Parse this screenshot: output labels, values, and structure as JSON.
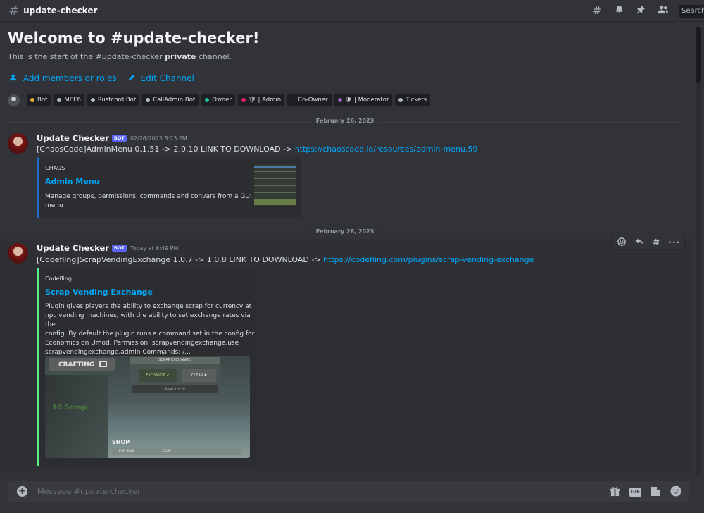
{
  "header": {
    "channel_name": "update-checker",
    "search_placeholder": "Search"
  },
  "welcome": {
    "title": "Welcome to #update-checker!",
    "sub_prefix": "This is the start of the #update-checker",
    "sub_bold": "private",
    "sub_suffix": "channel.",
    "add_members": "Add members or roles",
    "edit_channel": "Edit Channel"
  },
  "roles": [
    {
      "label": "Bot",
      "color": "#f0b232"
    },
    {
      "label": "MEE6",
      "color": "#b5bac1"
    },
    {
      "label": "Rustcord Bot",
      "color": "#b5bac1"
    },
    {
      "label": "CallAdmin Bot",
      "color": "#b5bac1"
    },
    {
      "label": "Owner",
      "color": "#1abc9c"
    },
    {
      "label": "🛡 | Admin",
      "color": "#e91e63"
    },
    {
      "label": "Co-Owner",
      "color": "#1e1f22"
    },
    {
      "label": "🛡 | Moderator",
      "color": "#9b59b6"
    },
    {
      "label": "Tickets",
      "color": "#b5bac1"
    }
  ],
  "messages": [
    {
      "date_divider": "February 26, 2023",
      "author": "Update Checker",
      "bot_tag": "BOT",
      "timestamp": "02/26/2023 8:23 PM",
      "text": "[ChaosCode]AdminMenu 0.1.51 -> 2.0.10 LINK TO DOWNLOAD -> ",
      "link": "https://chaoscode.io/resources/admin-menu.59",
      "embed": {
        "provider": "CHAOS",
        "title": "Admin Menu",
        "description_lines": [
          "Manage groups, permissions, commands and convars from a GUI",
          "menu"
        ],
        "color": "#1f6fcf"
      }
    },
    {
      "date_divider": "February 28, 2023",
      "author": "Update Checker",
      "bot_tag": "BOT",
      "timestamp": "Today at 6:49 PM",
      "text": "[Codefling]ScrapVendingExchange 1.0.7 -> 1.0.8 LINK TO DOWNLOAD -> ",
      "link": "https://codefling.com/plugins/scrap-vending-exchange",
      "embed": {
        "provider": "Codefling",
        "title": "Scrap Vending Exchange",
        "description_lines": [
          "Plugin gives players the ability to exchange scrap for currency at",
          "npc vending machines, with the ability to set exchange rates via the",
          "config. By default the plugin runs a command set in the config for",
          "Economics on Umod. Permission: scrapvendingexchange.use",
          "scrapvendingexchange.admin Commands: /..."
        ],
        "color": "#57f287",
        "image": {
          "crafting": "CRAFTING",
          "panel_header": "SCRAP EXCHANGE",
          "exchange_btn": "EXCHANGE ✔",
          "clear_btn": "CLEAR ✖",
          "slider_text": "Scrap 0 → 10",
          "green_text": "10 Scrap",
          "shop": "SHOP",
          "for_sale": "FOR SALE",
          "cost": "COST"
        }
      }
    }
  ],
  "composer": {
    "placeholder": "Message #update-checker"
  }
}
